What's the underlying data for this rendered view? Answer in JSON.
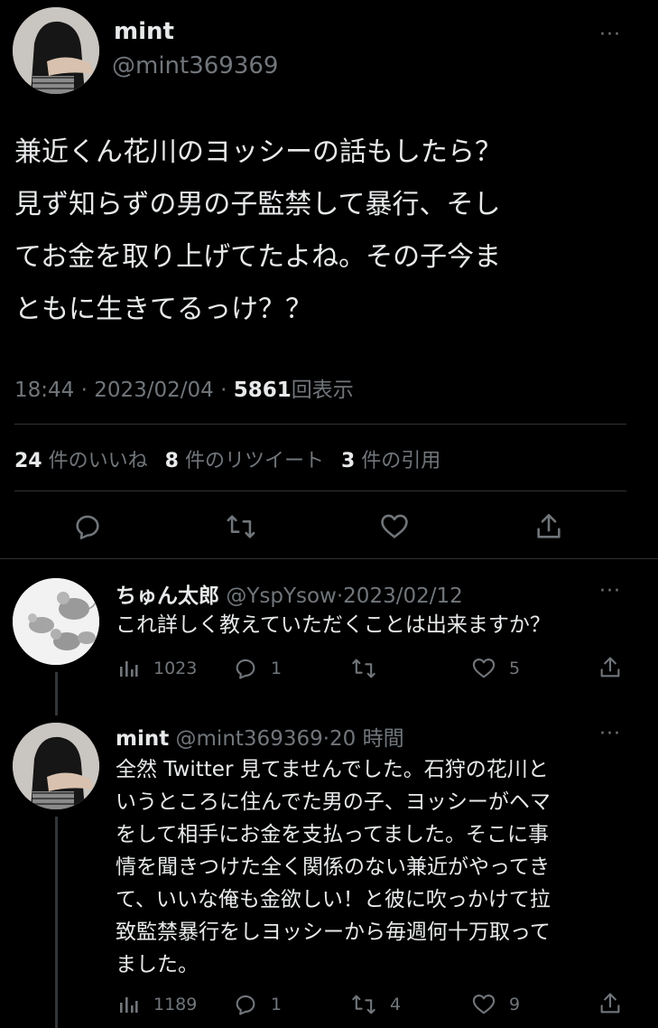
{
  "main_tweet": {
    "display_name": "mint",
    "handle": "@mint369369",
    "lines": [
      "兼近くん花川のヨッシーの話もしたら？",
      "見ず知らずの男の子監禁して暴行、そし",
      "てお金を取り上げてたよね。その子今ま",
      "ともに生きてるっけ？？"
    ],
    "time": "18:44",
    "date": "2023/02/04",
    "sep": "·",
    "views_count": "5861",
    "views_label": "回表示",
    "likes_count": "24",
    "likes_label": "件のいいね",
    "retweets_count": "8",
    "retweets_label": "件のリツイート",
    "quotes_count": "3",
    "quotes_label": "件の引用"
  },
  "replies": [
    {
      "display_name": "ちゅん太郎",
      "handle": "@YspYsow",
      "sep": "·",
      "date": "2023/02/12",
      "lines": [
        "これ詳しく教えていただくことは出来ますか？"
      ],
      "views": "1023",
      "comments": "1",
      "retweets": "",
      "likes": "5"
    },
    {
      "display_name": "mint",
      "handle": "@mint369369",
      "sep": "·",
      "date": "20 時間",
      "lines": [
        "全然 Twitter 見てませんでした。石狩の花川と",
        "いうところに住んでた男の子、ヨッシーがヘマ",
        "をして相手にお金を支払ってました。そこに事",
        "情を聞きつけた全く関係のない兼近がやってき",
        "て、いいな俺も金欲しい！と彼に吹っかけて拉",
        "致監禁暴行をしヨッシーから毎週何十万取って",
        "ました。"
      ],
      "views": "1189",
      "comments": "1",
      "retweets": "4",
      "likes": "9"
    }
  ],
  "more_label": "···",
  "colors": {
    "background": "#000000",
    "text": "#e7e9ea",
    "muted": "#71767b",
    "divider": "#2f3336"
  }
}
